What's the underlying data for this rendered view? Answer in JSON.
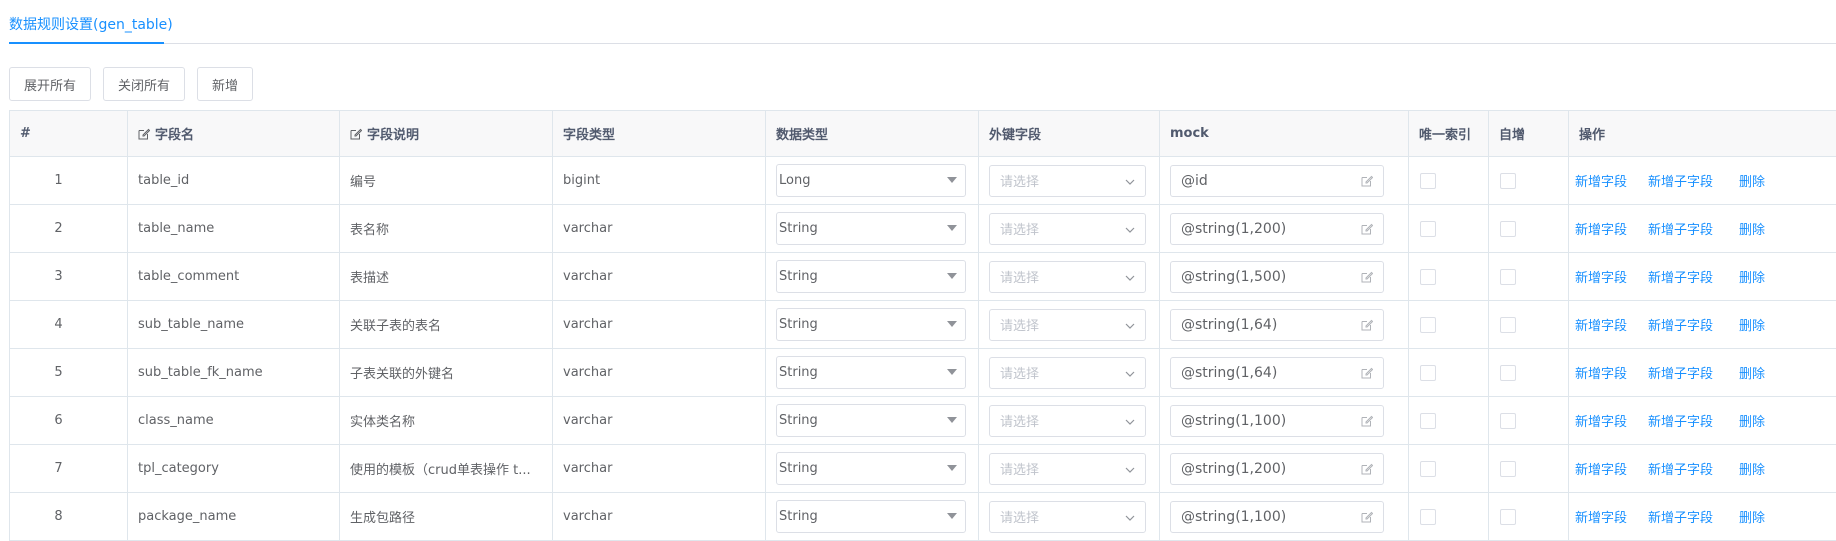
{
  "tabs": [
    {
      "label": "数据规则设置(gen_table)",
      "active": true
    }
  ],
  "toolbar": {
    "expand_all": "展开所有",
    "collapse_all": "关闭所有",
    "add": "新增"
  },
  "table": {
    "headers": [
      "#",
      "字段名",
      "字段说明",
      "字段类型",
      "数据类型",
      "外键字段",
      "mock",
      "唯一索引",
      "自增",
      "操作"
    ],
    "fk_placeholder": "请选择",
    "actions": {
      "add_field": "新增字段",
      "add_child_field": "新增子字段",
      "delete": "删除"
    },
    "rows": [
      {
        "no": "1",
        "name": "table_id",
        "desc": "编号",
        "field_type": "bigint",
        "data_type": "Long",
        "mock": "@id",
        "unique": false,
        "auto_inc": false
      },
      {
        "no": "2",
        "name": "table_name",
        "desc": "表名称",
        "field_type": "varchar",
        "data_type": "String",
        "mock": "@string(1,200)",
        "unique": false,
        "auto_inc": false
      },
      {
        "no": "3",
        "name": "table_comment",
        "desc": "表描述",
        "field_type": "varchar",
        "data_type": "String",
        "mock": "@string(1,500)",
        "unique": false,
        "auto_inc": false
      },
      {
        "no": "4",
        "name": "sub_table_name",
        "desc": "关联子表的表名",
        "field_type": "varchar",
        "data_type": "String",
        "mock": "@string(1,64)",
        "unique": false,
        "auto_inc": false
      },
      {
        "no": "5",
        "name": "sub_table_fk_name",
        "desc": "子表关联的外键名",
        "field_type": "varchar",
        "data_type": "String",
        "mock": "@string(1,64)",
        "unique": false,
        "auto_inc": false
      },
      {
        "no": "6",
        "name": "class_name",
        "desc": "实体类名称",
        "field_type": "varchar",
        "data_type": "String",
        "mock": "@string(1,100)",
        "unique": false,
        "auto_inc": false
      },
      {
        "no": "7",
        "name": "tpl_category",
        "desc": "使用的模板（crud单表操作 t...",
        "field_type": "varchar",
        "data_type": "String",
        "mock": "@string(1,200)",
        "unique": false,
        "auto_inc": false
      },
      {
        "no": "8",
        "name": "package_name",
        "desc": "生成包路径",
        "field_type": "varchar",
        "data_type": "String",
        "mock": "@string(1,100)",
        "unique": false,
        "auto_inc": false
      }
    ]
  },
  "colors": {
    "primary": "#1890ff",
    "border": "#dcdfe6",
    "header_bg": "#f8f8f9",
    "text": "#606266"
  }
}
